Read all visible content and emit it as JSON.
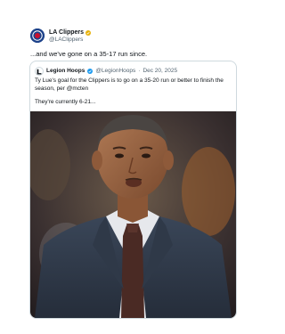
{
  "post": {
    "author_name": "LA Clippers",
    "author_handle": "@LAClippers",
    "text": "...and we've gone on a 35-17 run since."
  },
  "quoted_post": {
    "author_name": "Legion Hoops",
    "author_handle": "@LegionHoops",
    "separator": "·",
    "date": "Dec 20, 2025",
    "text_line1": "Ty Lue's goal for the Clippers is to go on a 35-20 run or better to finish the season, per @mcten",
    "text_line2": "They're currently 6-21..."
  },
  "colors": {
    "clippers_blue": "#1d428a",
    "badge_gold": "#e8b20d",
    "badge_blue": "#1d9bf0",
    "muted_text": "#536471",
    "border": "#cfd9de"
  },
  "icons": [
    "clippers-logo-icon",
    "gold-verified-badge-icon",
    "legion-hoops-logo-icon",
    "blue-verified-badge-icon"
  ]
}
